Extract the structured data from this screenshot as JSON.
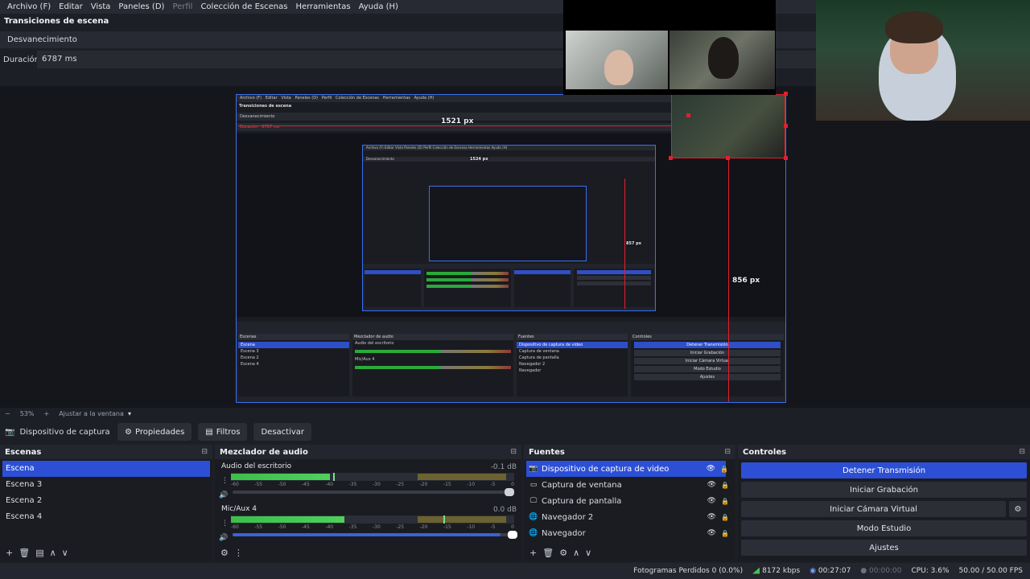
{
  "menu": [
    "Archivo (F)",
    "Editar",
    "Vista",
    "Paneles (D)",
    "Perfil",
    "Colección de Escenas",
    "Herramientas",
    "Ayuda (H)"
  ],
  "menu_disabled": "Perfil",
  "transitions": {
    "title": "Transiciones de escena",
    "selected": "Desvanecimiento",
    "duration_label": "Duración",
    "duration_value": "6787 ms"
  },
  "preview": {
    "measure_width": "1521 px",
    "measure_height": "856 px",
    "nested_measure_width": "1524 px",
    "nested_measure_height": "857 px"
  },
  "zoom": {
    "minus": "−",
    "level": "53%",
    "plus": "+",
    "fit": "Ajustar a la ventana"
  },
  "source_toolbar": {
    "source_name": "Dispositivo de captura de v",
    "properties": "Propiedades",
    "filters": "Filtros",
    "deactivate": "Desactivar"
  },
  "scenes": {
    "title": "Escenas",
    "items": [
      "Escena",
      "Escena 3",
      "Escena 2",
      "Escena 4"
    ],
    "selected_index": 0
  },
  "mixer": {
    "title": "Mezclador de audio",
    "channels": [
      {
        "name": "Audio del escritorio",
        "db": "-0.1 dB",
        "level": 0.35,
        "peak": 0.36
      },
      {
        "name": "Mic/Aux 4",
        "db": "0.0 dB",
        "level": 0.4,
        "peak": 0.75
      }
    ],
    "ticks": [
      "-60",
      "-55",
      "-50",
      "-45",
      "-40",
      "-35",
      "-30",
      "-25",
      "-20",
      "-15",
      "-10",
      "-5",
      "0"
    ]
  },
  "sources": {
    "title": "Fuentes",
    "items": [
      {
        "label": "Dispositivo de captura de video",
        "icon": "camera-icon"
      },
      {
        "label": "Captura de ventana",
        "icon": "window-icon"
      },
      {
        "label": "Captura de pantalla",
        "icon": "monitor-icon"
      },
      {
        "label": "Navegador 2",
        "icon": "globe-icon"
      },
      {
        "label": "Navegador",
        "icon": "globe-icon"
      }
    ],
    "selected_index": 0
  },
  "controls": {
    "title": "Controles",
    "stop_stream": "Detener Transmisión",
    "start_recording": "Iniciar Grabación",
    "start_virtual_cam": "Iniciar Cámara Virtual",
    "studio_mode": "Modo Estudio",
    "settings": "Ajustes"
  },
  "status": {
    "dropped_frames": "Fotogramas Perdidos 0 (0.0%)",
    "bitrate": "8172 kbps",
    "stream_time": "00:27:07",
    "rec_time": "00:00:00",
    "cpu": "CPU: 3.6%",
    "fps": "50.00 / 50.00 FPS"
  },
  "colors": {
    "accent": "#2c4fd6",
    "guide": "#e0202a"
  }
}
